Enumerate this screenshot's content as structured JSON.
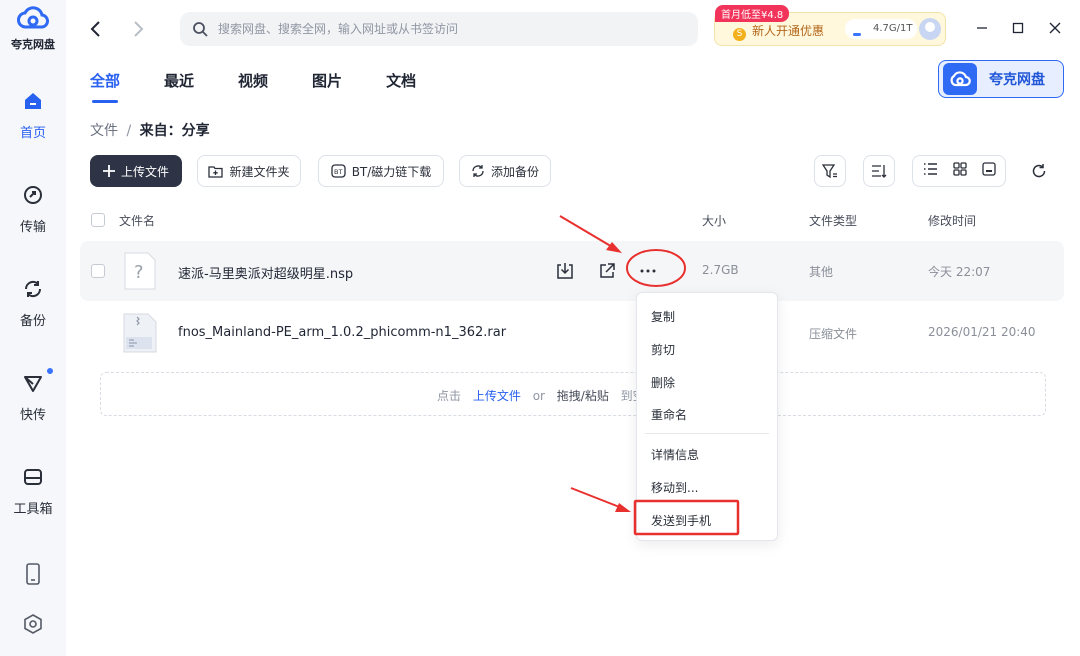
{
  "app": {
    "name": "夸克网盘"
  },
  "sidebar": {
    "items": [
      {
        "label": "首页",
        "icon": "home-icon",
        "active": true
      },
      {
        "label": "传输",
        "icon": "transfer-icon"
      },
      {
        "label": "备份",
        "icon": "backup-icon"
      },
      {
        "label": "快传",
        "icon": "quick-send-icon",
        "badge": true
      },
      {
        "label": "工具箱",
        "icon": "toolbox-icon"
      }
    ],
    "bottom_icons": [
      "phone-icon",
      "settings-icon"
    ]
  },
  "search": {
    "placeholder": "搜索网盘、搜索全网，输入网址或从书签访问"
  },
  "promo": {
    "tag": "首月低至¥4.8",
    "text": "新人开通优惠",
    "coin": "S",
    "storage": "4.7G/1T"
  },
  "tabs": [
    {
      "label": "全部",
      "active": true
    },
    {
      "label": "最近"
    },
    {
      "label": "视频"
    },
    {
      "label": "图片"
    },
    {
      "label": "文档"
    }
  ],
  "brand_button": {
    "label": "夸克网盘"
  },
  "breadcrumb": {
    "root": "文件",
    "separator": "/",
    "current": "来自：分享"
  },
  "toolbar": {
    "upload": "上传文件",
    "new_folder": "新建文件夹",
    "bt_download": "BT/磁力链下载",
    "add_backup": "添加备份"
  },
  "table": {
    "headers": {
      "name": "文件名",
      "size": "大小",
      "type": "文件类型",
      "modified": "修改时间"
    },
    "rows": [
      {
        "name": "速派-马里奥派对超级明星.nsp",
        "size": "2.7GB",
        "type": "其他",
        "modified": "今天 22:07"
      },
      {
        "name": "fnos_Mainland-PE_arm_1.0.2_phicomm-n1_362.rar",
        "size": "",
        "type": "压缩文件",
        "modified": "2026/01/21 20:40"
      }
    ]
  },
  "dropzone": {
    "prefix": "点击",
    "link": "上传文件",
    "or": "or",
    "drag": "拖拽/粘贴",
    "suffix": "到空"
  },
  "context_menu": {
    "items": [
      "复制",
      "剪切",
      "删除",
      "重命名",
      "详情信息",
      "移动到...",
      "发送到手机"
    ]
  },
  "colors": {
    "accent": "#2860f0",
    "annotation": "#e8312f"
  }
}
